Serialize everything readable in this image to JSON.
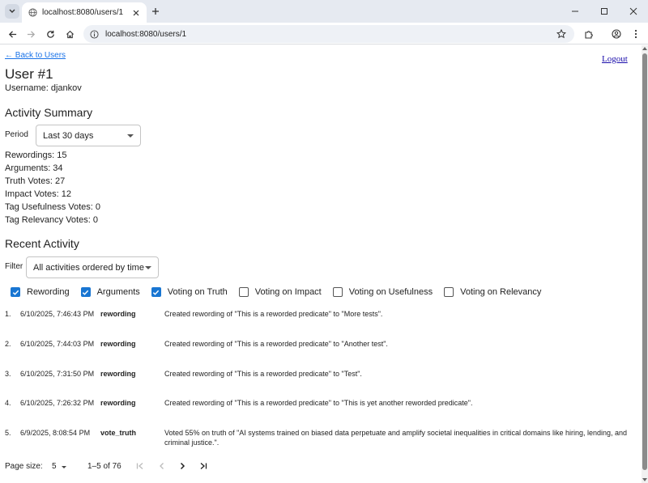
{
  "browser": {
    "tab_title": "localhost:8080/users/1",
    "url": "localhost:8080/users/1"
  },
  "page": {
    "back_link": "← Back to Users",
    "logout": "Logout",
    "title": "User #1",
    "username": "Username: djankov",
    "activity_summary": {
      "heading": "Activity Summary",
      "period_label": "Period",
      "period_value": "Last 30 days",
      "stats": [
        "Rewordings: 15",
        "Arguments: 34",
        "Truth Votes: 27",
        "Impact Votes: 12",
        "Tag Usefulness Votes: 0",
        "Tag Relevancy Votes: 0"
      ]
    },
    "recent_activity": {
      "heading": "Recent Activity",
      "filter_label": "Filter",
      "filter_value": "All activities ordered by time",
      "checkboxes": [
        {
          "label": "Rewording",
          "checked": true
        },
        {
          "label": "Arguments",
          "checked": true
        },
        {
          "label": "Voting on Truth",
          "checked": true
        },
        {
          "label": "Voting on Impact",
          "checked": false
        },
        {
          "label": "Voting on Usefulness",
          "checked": false
        },
        {
          "label": "Voting on Relevancy",
          "checked": false
        }
      ],
      "rows": [
        {
          "num": "1.",
          "time": "6/10/2025, 7:46:43 PM",
          "type": "rewording",
          "desc": "Created rewording of \"This is a reworded predicate\" to \"More tests\"."
        },
        {
          "num": "2.",
          "time": "6/10/2025, 7:44:03 PM",
          "type": "rewording",
          "desc": "Created rewording of \"This is a reworded predicate\" to \"Another test\"."
        },
        {
          "num": "3.",
          "time": "6/10/2025, 7:31:50 PM",
          "type": "rewording",
          "desc": "Created rewording of \"This is a reworded predicate\" to \"Test\"."
        },
        {
          "num": "4.",
          "time": "6/10/2025, 7:26:32 PM",
          "type": "rewording",
          "desc": "Created rewording of \"This is a reworded predicate\" to \"This is yet another reworded predicate\"."
        },
        {
          "num": "5.",
          "time": "6/9/2025, 8:08:54 PM",
          "type": "vote_truth",
          "desc": "Voted 55% on truth of \"AI systems trained on biased data perpetuate and amplify societal inequalities in critical domains like hiring, lending, and criminal justice.\"."
        }
      ],
      "pagination": {
        "page_size_label": "Page size:",
        "page_size_value": "5",
        "range": "1–5 of 76"
      }
    }
  },
  "colors": {
    "accent": "#1976d2",
    "link": "#1a73e8"
  }
}
